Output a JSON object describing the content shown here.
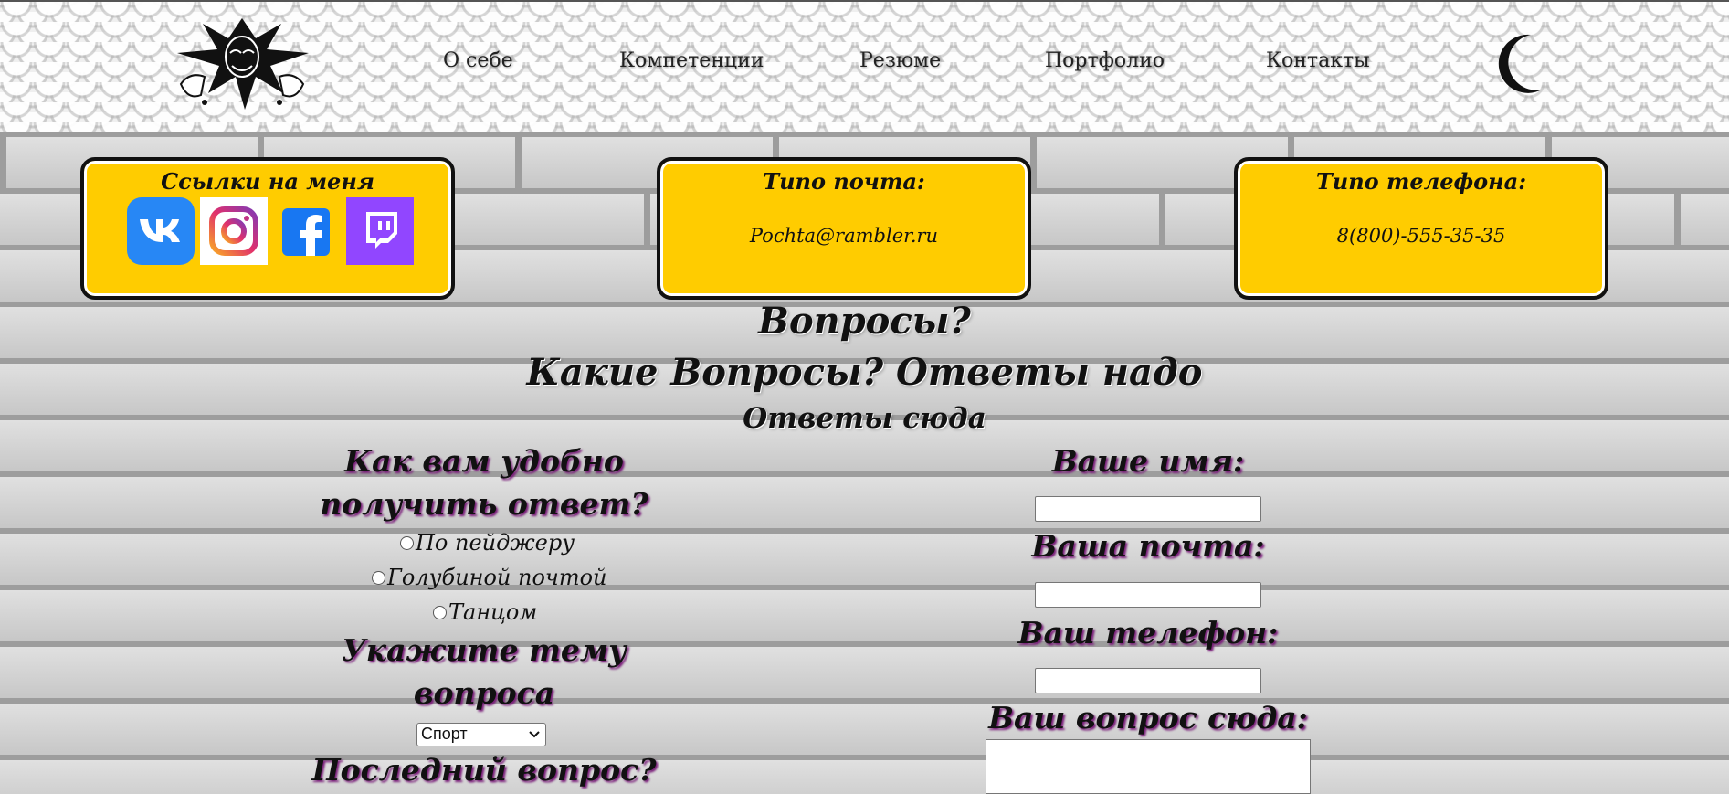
{
  "nav": {
    "items": [
      "О себе",
      "Компетенции",
      "Резюме",
      "Портфолио",
      "Контакты"
    ]
  },
  "cards": {
    "links": {
      "title": "Ссылки на меня"
    },
    "email": {
      "title": "Типо почта:",
      "value": "Pochta@rambler.ru"
    },
    "phone": {
      "title": "Типо телефона:",
      "value": "8(800)-555-35-35"
    }
  },
  "social_icons": [
    "vk-icon",
    "instagram-icon",
    "facebook-icon",
    "twitch-icon"
  ],
  "headings": {
    "line1": "Вопросы?",
    "line2": "Какие Вопросы? Ответы надо",
    "line3": "Ответы сюда"
  },
  "form": {
    "contact_method_label_1": "Как вам удобно",
    "contact_method_label_2": "получить ответ?",
    "options": [
      "По пейджеру",
      "Голубиной почтой",
      "Танцом"
    ],
    "topic_label_1": "Укажите тему",
    "topic_label_2": "вопроса",
    "topic_selected": "Спорт",
    "last_question_label": "Последний вопрос?",
    "name_label": "Ваше имя:",
    "email_label": "Ваша почта:",
    "phone_label": "Ваш телефон:",
    "question_label": "Ваш вопрос сюда:",
    "name_value": "",
    "email_value": "",
    "phone_value": "",
    "question_value": ""
  },
  "colors": {
    "card_bg": "#ffcc00",
    "label_shadow": "#7a1f7a",
    "vk": "#2787f5",
    "twitch": "#9146ff",
    "facebook": "#1877f2"
  }
}
